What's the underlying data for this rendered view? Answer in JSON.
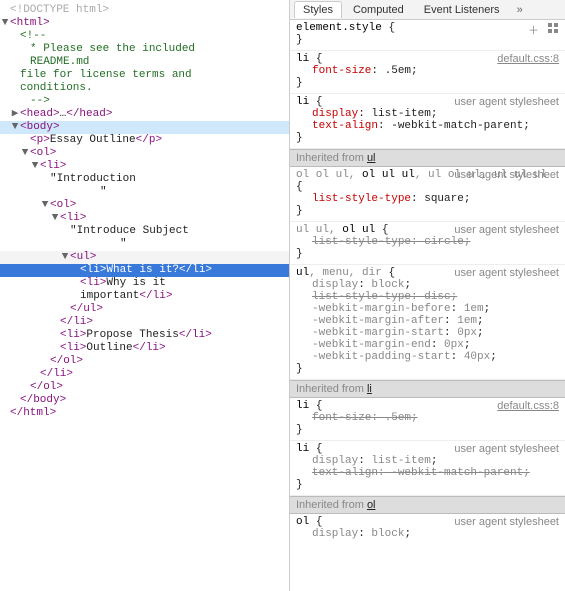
{
  "tree": {
    "doctype": "<!DOCTYPE html>",
    "html_open": "<html>",
    "html_close": "</html>",
    "comment_open": "<!--",
    "comment_l1": "* Please see the included README.md",
    "comment_l2": "file for license terms and conditions.",
    "comment_close": "-->",
    "head_open": "<head>",
    "head_ellipsis": "…",
    "head_close": "</head>",
    "body_open": "<body>",
    "body_close": "</body>",
    "p_open": "<p>",
    "p_text": "Essay Outline",
    "p_close": "</p>",
    "ol_open": "<ol>",
    "ol_close": "</ol>",
    "li_open": "<li>",
    "li_close": "</li>",
    "ul_open": "<ul>",
    "ul_close": "</ul>",
    "t_intro_open": "\"Introduction",
    "t_intro_close": "\"",
    "t_introsub_open": "\"Introduce Subject",
    "t_introsub_close": "\"",
    "li_what_open": "<li>",
    "li_what_text": "What is it?",
    "li_what_close": "</li>",
    "li_why_open": "<li>",
    "li_why_text": "Why is it important",
    "li_why_close": "</li>",
    "li_propose_open": "<li>",
    "li_propose_text": "Propose Thesis",
    "li_propose_close": "</li>",
    "li_outline_open": "<li>",
    "li_outline_text": "Outline",
    "li_outline_close": "</li>"
  },
  "tabs": {
    "styles": "Styles",
    "computed": "Computed",
    "event_listeners": "Event Listeners",
    "more": "»"
  },
  "styles_pane": {
    "element_style_selector": "element.style",
    "default_src": "default.css:8",
    "ua_src": "user agent stylesheet",
    "inherit_from": "Inherited from",
    "inherit_ul": "ul",
    "inherit_li": "li",
    "inherit_ol": "ol",
    "r1_sel": "li",
    "r1_prop": "font-size",
    "r1_val": ".5em",
    "r2_sel": "li",
    "r2a_prop": "display",
    "r2a_val": "list-item",
    "r2b_prop": "text-align",
    "r2b_val": "-webkit-match-parent",
    "r3_sel_gray": "ol ol ul, ",
    "r3_sel_match": "ol ul ul",
    "r3_sel_rest": ", ul ol ul, ul ul ul",
    "r3_prop": "list-style-type",
    "r3_val": "square",
    "r4_sel_gray": "ul ul, ",
    "r4_sel_match": "ol ul",
    "r4_prop": "list-style-type",
    "r4_val": "circle",
    "r5_sel_match": "ul",
    "r5_sel_rest": ", menu, dir",
    "r5a_prop": "display",
    "r5a_val": "block",
    "r5b_prop": "list-style-type",
    "r5b_val": "disc",
    "r5c_prop": "-webkit-margin-before",
    "r5c_val": "1em",
    "r5d_prop": "-webkit-margin-after",
    "r5d_val": "1em",
    "r5e_prop": "-webkit-margin-start",
    "r5e_val": "0px",
    "r5f_prop": "-webkit-margin-end",
    "r5f_val": "0px",
    "r5g_prop": "-webkit-padding-start",
    "r5g_val": "40px",
    "r6_sel": "li",
    "r6_prop": "font-size",
    "r6_val": ".5em",
    "r7_sel": "li",
    "r7a_prop": "display",
    "r7a_val": "list-item",
    "r7b_prop": "text-align",
    "r7b_val": "-webkit-match-parent",
    "r8_sel": "ol",
    "r8_prop": "display",
    "r8_val": "block"
  }
}
